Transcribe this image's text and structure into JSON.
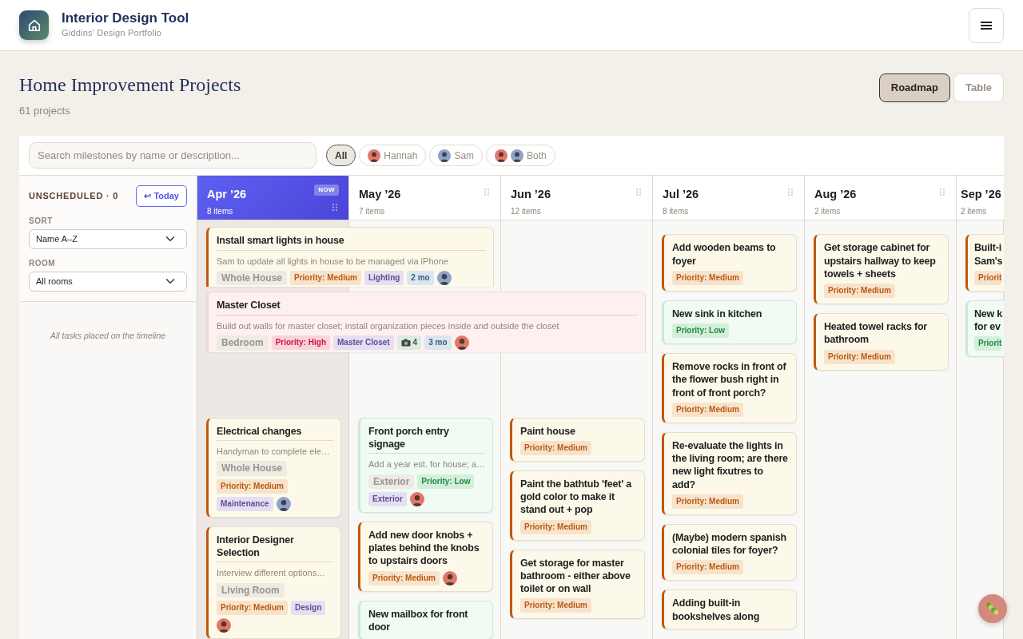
{
  "app": {
    "title": "Interior Design Tool",
    "subtitle": "Giddins' Design Portfolio"
  },
  "page": {
    "title": "Home Improvement Projects",
    "count": "61 projects"
  },
  "views": [
    {
      "label": "Roadmap",
      "selected": true
    },
    {
      "label": "Table",
      "selected": false
    }
  ],
  "search": {
    "placeholder": "Search milestones by name or description..."
  },
  "filters": [
    {
      "label": "All",
      "selected": true
    },
    {
      "label": "Hannah",
      "selected": false,
      "avatars": [
        {
          "color": "#e0786a"
        }
      ]
    },
    {
      "label": "Sam",
      "selected": false,
      "avatars": [
        {
          "color": "#8fa3c9"
        }
      ]
    },
    {
      "label": "Both",
      "selected": false,
      "avatars": [
        {
          "color": "#e0786a"
        },
        {
          "color": "#8fa3c9"
        }
      ]
    }
  ],
  "sidebar": {
    "unscheduled": "UNSCHEDULED · 0",
    "today_button": {
      "icon": "↩",
      "label": "Today"
    },
    "sort": {
      "label": "SORT",
      "value": "Name A–Z"
    },
    "room": {
      "label": "ROOM",
      "value": "All rooms"
    },
    "note": "All tasks placed on the timeline"
  },
  "months": [
    {
      "label": "Apr ’26",
      "count": "8 items",
      "current": true,
      "badge": "NOW",
      "grip": true,
      "spanning": [
        {
          "title": "Install smart lights in house",
          "description": "Sam to update all lights in house to be managed via iPhone",
          "room": "Whole House",
          "kind": "medium",
          "priority_label": "Priority: Medium",
          "tags": [
            "Lighting"
          ],
          "duration": "2 mo",
          "avatars": [
            {
              "color": "#8fa3c9"
            }
          ]
        },
        {
          "title": "Master Closet",
          "description": "Build out walls for master closet; install organization pieces inside and outside the closet",
          "room": "Bedroom",
          "kind": "high",
          "priority_label": "Priority: High",
          "tags": [
            "Master Closet"
          ],
          "photos": "4",
          "duration": "3 mo",
          "avatars": [
            {
              "color": "#e0786a"
            }
          ]
        }
      ],
      "cards": [
        {
          "title": "Electrical changes",
          "description": "Handyman to complete ele…",
          "room": "Whole House",
          "kind": "medium",
          "priority_label": "Priority: Medium",
          "tags": [
            "Maintenance"
          ],
          "avatars": [
            {
              "color": "#8fa3c9"
            }
          ]
        },
        {
          "title": "Interior Designer Selection",
          "description": "Interview different options…",
          "room": "Living Room",
          "kind": "medium",
          "priority_label": "Priority: Medium",
          "tags": [
            "Design"
          ],
          "avatars": [
            {
              "color": "#e0786a"
            }
          ]
        }
      ]
    },
    {
      "label": "May ’26",
      "count": "7 items",
      "current": false,
      "grip": true,
      "cards": [
        {
          "title": "Front porch entry signage",
          "description": "Add a year est. for house; a…",
          "room": "Exterior",
          "kind": "low",
          "priority_label": "Priority: Low",
          "tags": [
            "Exterior"
          ],
          "avatars": [
            {
              "color": "#e0786a"
            }
          ]
        },
        {
          "title": "Add new door knobs + plates behind the knobs to upstairs doors",
          "kind": "medium",
          "priority_label": "Priority: Medium",
          "avatars": [
            {
              "color": "#e0786a"
            }
          ]
        },
        {
          "title": "New mailbox for front door",
          "kind": "low"
        }
      ]
    },
    {
      "label": "Jun ’26",
      "count": "12 items",
      "current": false,
      "grip": true,
      "cards": [
        {
          "title": "Paint house",
          "kind": "medium",
          "priority_label": "Priority: Medium"
        },
        {
          "title": "Paint the bathtub 'feet' a gold color to make it stand out + pop",
          "kind": "medium",
          "priority_label": "Priority: Medium"
        },
        {
          "title": "Get storage for master bathroom - either above toilet or on wall",
          "kind": "medium",
          "priority_label": "Priority: Medium"
        }
      ]
    },
    {
      "label": "Jul ’26",
      "count": "8 items",
      "current": false,
      "grip": true,
      "cards": [
        {
          "title": "Add wooden beams to foyer",
          "kind": "medium",
          "priority_label": "Priority: Medium"
        },
        {
          "title": "New sink in kitchen",
          "kind": "low",
          "priority_label": "Priority: Low"
        },
        {
          "title": "Remove rocks in front of the flower bush right in front of front porch?",
          "kind": "medium",
          "priority_label": "Priority: Medium"
        },
        {
          "title": "Re-evaluate the lights in the living room; are there new light fixutres to add?",
          "kind": "medium",
          "priority_label": "Priority: Medium"
        },
        {
          "title": "(Maybe) modern spanish colonial tiles for foyer?",
          "kind": "medium",
          "priority_label": "Priority: Medium"
        },
        {
          "title": "Adding built-in bookshelves along",
          "kind": "medium"
        }
      ]
    },
    {
      "label": "Aug ’26",
      "count": "2 items",
      "current": false,
      "grip": true,
      "cards": [
        {
          "title": "Get storage cabinet for upstairs hallway to keep towels + sheets",
          "kind": "medium",
          "priority_label": "Priority: Medium"
        },
        {
          "title": "Heated towel racks for bathroom",
          "kind": "medium",
          "priority_label": "Priority: Medium"
        }
      ]
    },
    {
      "label": "Sep ’26",
      "count": "2 items",
      "current": false,
      "grip": false,
      "cards": [
        {
          "title": "Built-i Sam's",
          "kind": "medium",
          "priority_label": "Priorit"
        },
        {
          "title": "New k for ev",
          "kind": "low",
          "priority_label": "Priorit"
        }
      ]
    }
  ]
}
